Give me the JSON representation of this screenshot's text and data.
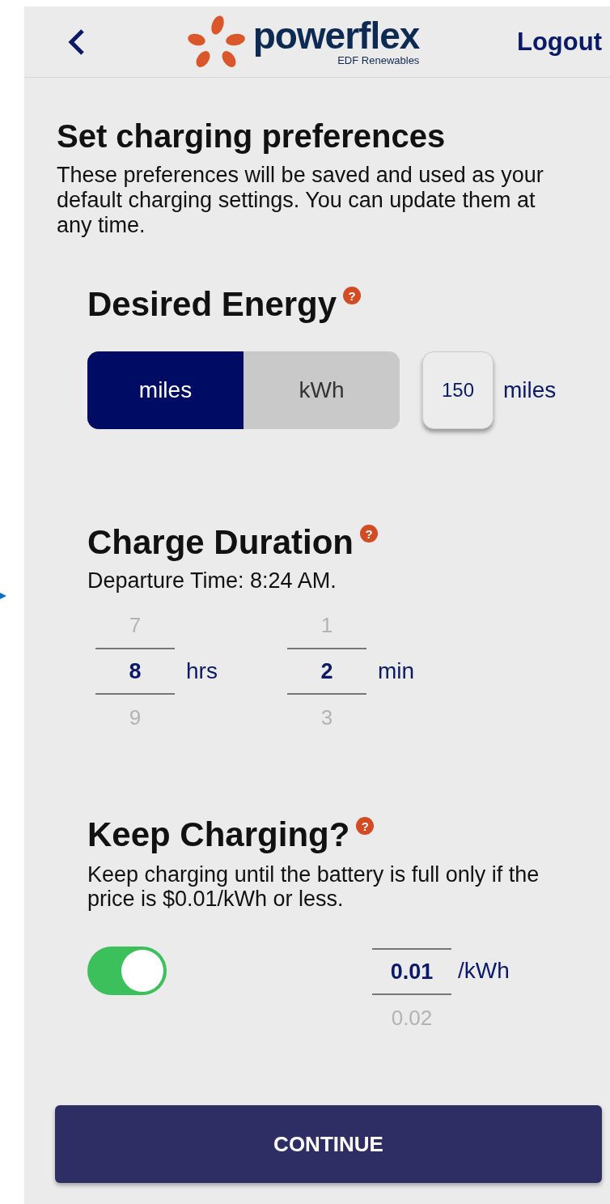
{
  "header": {
    "brand": "powerflex",
    "brand_sub": "EDF Renewables",
    "logout": "Logout"
  },
  "title": "Set charging preferences",
  "intro": "These preferences will be saved and used as your default charging settings. You can update them at any time.",
  "energy": {
    "heading": "Desired Energy",
    "help": "?",
    "units": [
      {
        "label": "miles",
        "selected": true
      },
      {
        "label": "kWh",
        "selected": false
      }
    ],
    "value": "150",
    "value_unit": "miles"
  },
  "duration": {
    "heading": "Charge Duration",
    "help": "?",
    "departure": "Departure Time: 8:24 AM.",
    "pickers": [
      {
        "prev": "7",
        "value": "8",
        "next": "9",
        "unit": "hrs"
      },
      {
        "prev": "1",
        "value": "2",
        "next": "3",
        "unit": "min"
      }
    ]
  },
  "keep": {
    "heading": "Keep Charging?",
    "help": "?",
    "text": "Keep charging until the battery is full only if the price is $0.01/kWh or less.",
    "on": true,
    "picker": {
      "value": "0.01",
      "next": "0.02",
      "unit": "/kWh"
    }
  },
  "continue": "CONTINUE"
}
